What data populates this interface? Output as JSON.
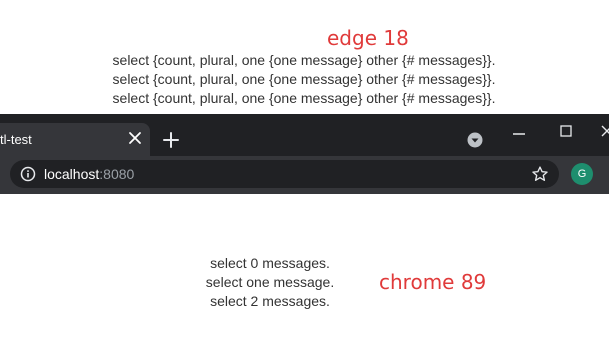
{
  "annotations": {
    "edge": "edge 18",
    "chrome": "chrome 89"
  },
  "edge_output": {
    "lines": [
      "select {count, plural, one {one message} other {# messages}}.",
      "select {count, plural, one {one message} other {# messages}}.",
      "select {count, plural, one {one message} other {# messages}}."
    ]
  },
  "chrome_output": {
    "lines": [
      "select 0 messages.",
      "select one message.",
      "select 2 messages."
    ]
  },
  "browser": {
    "tab_title": "tl-test",
    "tab_close_glyph": "✕",
    "new_tab_glyph": "+",
    "url_host": "localhost",
    "url_port": ":8080",
    "avatar_letter": "G",
    "icons": [
      "close-icon",
      "plus-icon",
      "chevron-down-icon",
      "minimize-icon",
      "maximize-icon",
      "info-icon",
      "star-icon"
    ],
    "colors": {
      "titlebar": "#202124",
      "toolbar": "#35363a",
      "avatar": "#1e8e6e",
      "annotation": "#e03a3a"
    }
  }
}
